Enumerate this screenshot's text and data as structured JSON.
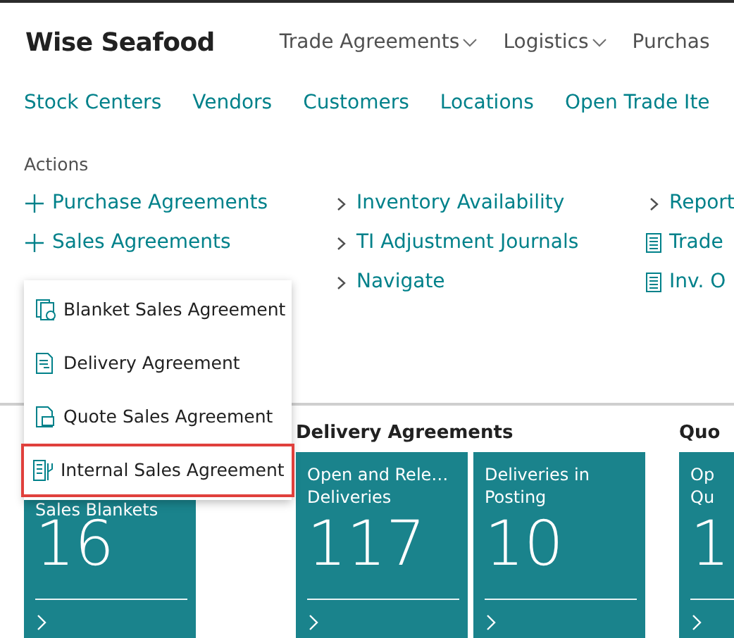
{
  "app_title": "Wise Seafood",
  "menus": [
    {
      "label": "Trade Agreements",
      "dropdown": true
    },
    {
      "label": "Logistics",
      "dropdown": true
    },
    {
      "label": "Purchas",
      "dropdown": false
    }
  ],
  "nav_links": [
    "Stock Centers",
    "Vendors",
    "Customers",
    "Locations",
    "Open Trade Ite"
  ],
  "actions": {
    "title": "Actions",
    "columns": [
      [
        {
          "kind": "add",
          "label": "Purchase Agreements"
        },
        {
          "kind": "add",
          "label": "Sales Agreements"
        }
      ],
      [
        {
          "kind": "group",
          "label": "Inventory Availability"
        },
        {
          "kind": "group",
          "label": "TI Adjustment Journals"
        },
        {
          "kind": "group",
          "label": "Navigate"
        }
      ],
      [
        {
          "kind": "group",
          "label": "Report"
        },
        {
          "kind": "report",
          "label": "Trade"
        },
        {
          "kind": "report",
          "label": "Inv. O"
        }
      ]
    ]
  },
  "dropdown": {
    "items": [
      {
        "label": "Blanket Sales Agreement",
        "kind": "blanket",
        "selected": false
      },
      {
        "label": "Delivery Agreement",
        "kind": "delivery",
        "selected": false
      },
      {
        "label": "Quote Sales Agreement",
        "kind": "quote",
        "selected": false
      },
      {
        "label": "Internal Sales Agreement",
        "kind": "internal",
        "selected": true
      }
    ]
  },
  "sections": [
    {
      "tiles": [
        {
          "title_lines": [
            "Sales Blankets"
          ],
          "count": "16"
        }
      ]
    },
    {
      "heading": "Delivery Agreements",
      "tiles": [
        {
          "title_lines": [
            "Open and Rele…",
            "Deliveries"
          ],
          "count": "117"
        },
        {
          "title_lines": [
            "Deliveries in",
            "Posting"
          ],
          "count": "10"
        }
      ]
    },
    {
      "heading": "Quo",
      "tiles": [
        {
          "title_lines": [
            "Op",
            "Qu"
          ],
          "count": "1"
        }
      ]
    }
  ]
}
